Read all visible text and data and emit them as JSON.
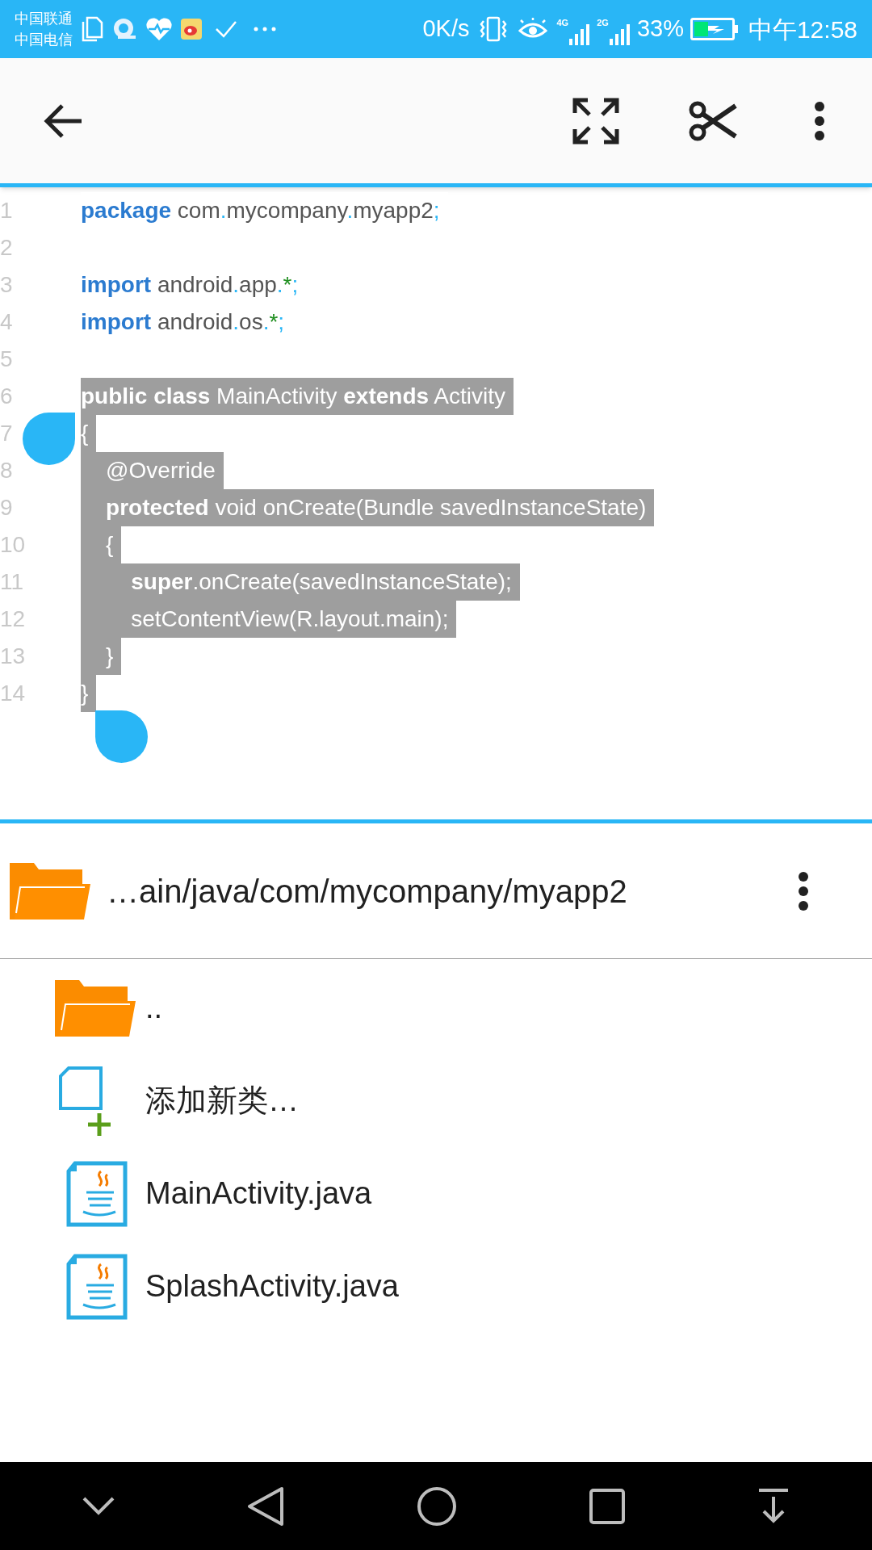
{
  "status_bar": {
    "carriers": [
      "中国联通",
      "中国电信"
    ],
    "speed": "0K/s",
    "network_1": "4G",
    "network_2": "2G",
    "battery": "33%",
    "time": "中午12:58"
  },
  "code": {
    "lines": [
      {
        "number": "1",
        "selected": false,
        "tokens": [
          {
            "kind": "keyword",
            "text": "package"
          },
          {
            "kind": "plain",
            "text": " com"
          },
          {
            "kind": "punct",
            "text": "."
          },
          {
            "kind": "plain",
            "text": "mycompany"
          },
          {
            "kind": "punct",
            "text": "."
          },
          {
            "kind": "plain",
            "text": "myapp2"
          },
          {
            "kind": "punct",
            "text": ";"
          }
        ]
      },
      {
        "number": "2",
        "selected": false
      },
      {
        "number": "3",
        "selected": false,
        "tokens": [
          {
            "kind": "keyword",
            "text": "import"
          },
          {
            "kind": "plain",
            "text": " android"
          },
          {
            "kind": "punct",
            "text": "."
          },
          {
            "kind": "plain",
            "text": "app"
          },
          {
            "kind": "punct",
            "text": "."
          },
          {
            "kind": "star",
            "text": "*"
          },
          {
            "kind": "punct",
            "text": ";"
          }
        ]
      },
      {
        "number": "4",
        "selected": false,
        "tokens": [
          {
            "kind": "keyword",
            "text": "import"
          },
          {
            "kind": "plain",
            "text": " android"
          },
          {
            "kind": "punct",
            "text": "."
          },
          {
            "kind": "plain",
            "text": "os"
          },
          {
            "kind": "punct",
            "text": "."
          },
          {
            "kind": "star",
            "text": "*"
          },
          {
            "kind": "punct",
            "text": ";"
          }
        ]
      },
      {
        "number": "5",
        "selected": false
      },
      {
        "number": "6",
        "selected": true,
        "tokens": [
          {
            "kind": "keyword",
            "text": "public class"
          },
          {
            "kind": "plain",
            "text": " MainActivity "
          },
          {
            "kind": "keyword",
            "text": "extends"
          },
          {
            "kind": "plain",
            "text": " Activity"
          }
        ]
      },
      {
        "number": "7",
        "selected": true,
        "tokens": [
          {
            "kind": "plain",
            "text": "{"
          }
        ]
      },
      {
        "number": "8",
        "selected": true,
        "tokens": [
          {
            "kind": "plain",
            "text": "    @Override"
          }
        ]
      },
      {
        "number": "9",
        "selected": true,
        "tokens": [
          {
            "kind": "keyword",
            "text": "    protected"
          },
          {
            "kind": "plain",
            "text": " void onCreate(Bundle savedInstanceState)"
          }
        ]
      },
      {
        "number": "10",
        "selected": true,
        "tokens": [
          {
            "kind": "plain",
            "text": "    {"
          }
        ]
      },
      {
        "number": "11",
        "selected": true,
        "tokens": [
          {
            "kind": "keyword",
            "text": "        super"
          },
          {
            "kind": "plain",
            "text": ".onCreate(savedInstanceState);"
          }
        ]
      },
      {
        "number": "12",
        "selected": true,
        "tokens": [
          {
            "kind": "plain",
            "text": "        setContentView(R.layout.main);"
          }
        ]
      },
      {
        "number": "13",
        "selected": true,
        "tokens": [
          {
            "kind": "plain",
            "text": "    }"
          }
        ]
      },
      {
        "number": "14",
        "selected": true,
        "tokens": [
          {
            "kind": "plain",
            "text": "}"
          }
        ]
      }
    ]
  },
  "path_bar": {
    "path": "…ain/java/com/mycompany/myapp2"
  },
  "files": [
    {
      "kind": "folder",
      "name": ".."
    },
    {
      "kind": "new-class",
      "name": "添加新类…"
    },
    {
      "kind": "java",
      "name": "MainActivity.java"
    },
    {
      "kind": "java",
      "name": "SplashActivity.java"
    }
  ]
}
